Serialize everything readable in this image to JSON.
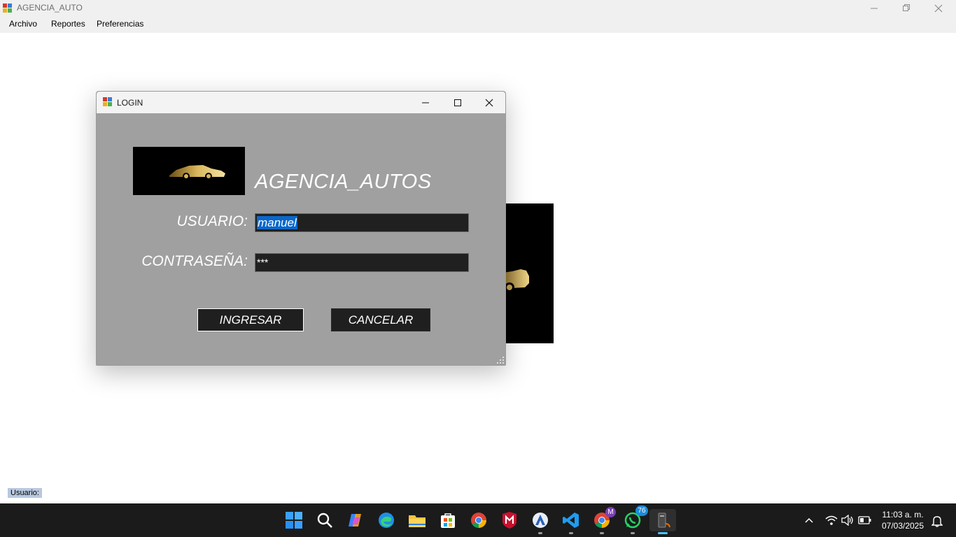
{
  "window": {
    "title": "AGENCIA_AUTO",
    "controls": {
      "minimize_icon": "minimize-icon",
      "restore_icon": "restore-icon",
      "close_icon": "close-icon"
    }
  },
  "menu": {
    "items": [
      {
        "label": "Archivo"
      },
      {
        "label": "Reportes"
      },
      {
        "label": "Preferencias"
      }
    ]
  },
  "dialog": {
    "title": "LOGIN",
    "heading": "AGENCIA_AUTOS",
    "user_label": "USUARIO:",
    "user_value": "manuel",
    "password_label": "CONTRASEÑA:",
    "password_value": "***",
    "submit_label": "INGRESAR",
    "cancel_label": "CANCELAR",
    "background_color": "#a0a0a0",
    "field_color": "#202020"
  },
  "status": {
    "user_label": "Usuario:"
  },
  "taskbar": {
    "icons": [
      "windows-start-icon",
      "search-icon",
      "copilot-icon",
      "edge-icon",
      "file-explorer-icon",
      "store-icon",
      "chrome-icon",
      "mcafee-icon",
      "app-icon",
      "vscode-icon",
      "chrome-profile-icon",
      "whatsapp-icon",
      "java-app-icon"
    ],
    "chrome_profile_badge": "M",
    "whatsapp_badge": "76",
    "tray_icons": [
      "chevron-up-icon",
      "wifi-icon",
      "volume-icon",
      "battery-icon",
      "notification-bell-icon"
    ],
    "time": "11:03 a. m.",
    "date": "07/03/2025"
  }
}
